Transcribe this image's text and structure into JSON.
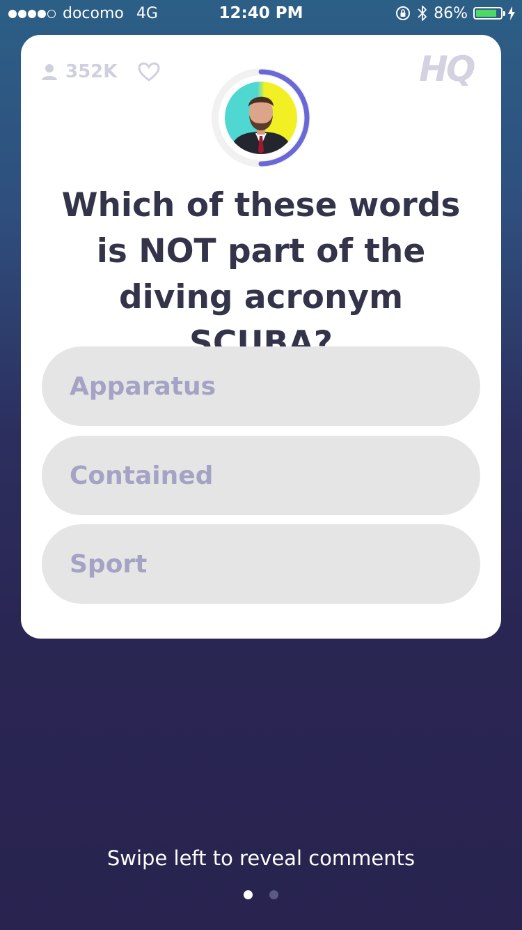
{
  "status_bar": {
    "carrier": "docomo",
    "network": "4G",
    "time": "12:40 PM",
    "battery_percent": "86%",
    "battery_level": 0.86,
    "icons": [
      "rotation-lock-icon",
      "bluetooth-icon",
      "battery-icon",
      "charging-bolt-icon"
    ]
  },
  "card": {
    "viewer_count": "352K",
    "logo_text": "HQ",
    "timer_progress": 0.5,
    "question": "Which of these words is NOT part of the diving acronym SCUBA?",
    "answers": [
      {
        "label": "Apparatus"
      },
      {
        "label": "Contained"
      },
      {
        "label": "Sport"
      }
    ]
  },
  "footer": {
    "hint": "Swipe left to reveal comments",
    "pages": 2,
    "active_page": 1
  },
  "colors": {
    "accent": "#6a67d6",
    "answer_text": "#a4a3c4",
    "answer_bg": "#e5e5e5",
    "question_text": "#33344a",
    "background_top": "#2c5f86",
    "background_bottom": "#28234f"
  }
}
